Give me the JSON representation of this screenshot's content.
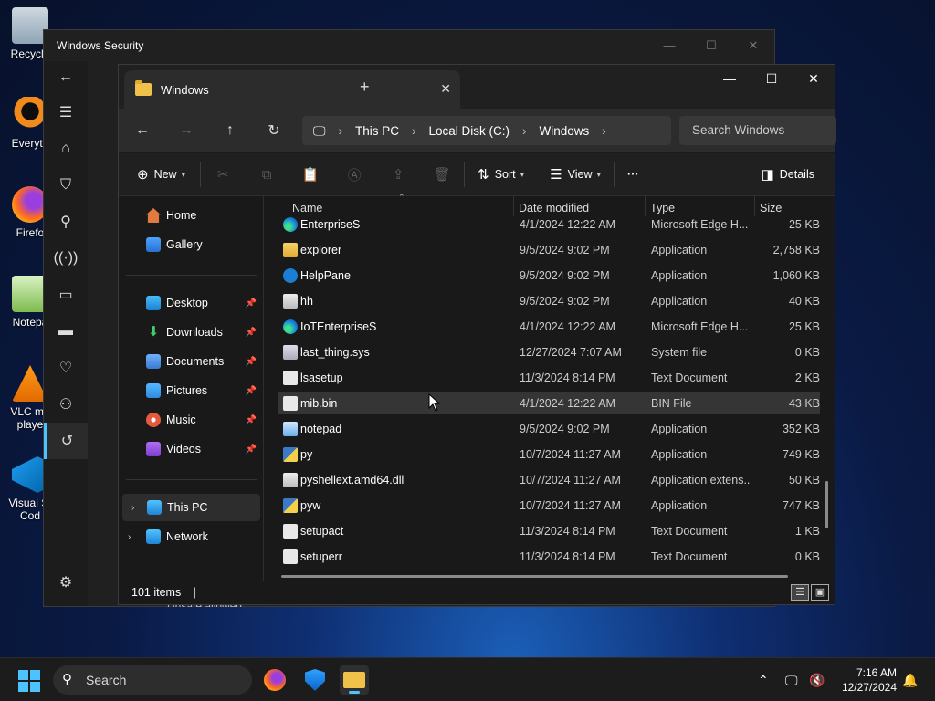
{
  "desktop": {
    "icons": [
      {
        "label": "Recycle",
        "icon": "recycle-bin-icon"
      },
      {
        "label": "Everyth",
        "icon": "everything-search-icon"
      },
      {
        "label": "Firefo",
        "icon": "firefox-icon"
      },
      {
        "label": "Notepa",
        "icon": "notepad-icon"
      },
      {
        "label": "VLC me",
        "label2": "playe",
        "icon": "vlc-icon"
      },
      {
        "label": "Visual St",
        "label2": "Cod",
        "icon": "vscode-icon"
      }
    ]
  },
  "security_window": {
    "title": "Windows Security",
    "sidebar_icons": [
      "back-arrow-icon",
      "hamburger-menu-icon",
      "home-icon",
      "shield-icon",
      "person-icon",
      "wifi-icon",
      "app-browser-icon",
      "laptop-icon",
      "heart-pulse-icon",
      "family-icon",
      "history-icon",
      "gear-icon"
    ],
    "partial_text": "Unsafe allowed"
  },
  "explorer": {
    "tab_title": "Windows",
    "breadcrumb": [
      "This PC",
      "Local Disk (C:)",
      "Windows"
    ],
    "search_placeholder": "Search Windows",
    "commands": {
      "new": "New",
      "sort": "Sort",
      "view": "View",
      "more": "···",
      "details": "Details"
    },
    "nav": {
      "home": "Home",
      "gallery": "Gallery",
      "desktop": "Desktop",
      "downloads": "Downloads",
      "documents": "Documents",
      "pictures": "Pictures",
      "music": "Music",
      "videos": "Videos",
      "this_pc": "This PC",
      "network": "Network"
    },
    "columns": {
      "name": "Name",
      "date": "Date modified",
      "type": "Type",
      "size": "Size"
    },
    "files": [
      {
        "name": "EnterpriseS",
        "date": "4/1/2024 12:22 AM",
        "type": "Microsoft Edge H...",
        "size": "25 KB",
        "icon": "edge-icon"
      },
      {
        "name": "explorer",
        "date": "9/5/2024 9:02 PM",
        "type": "Application",
        "size": "2,758 KB",
        "icon": "folder-app-icon"
      },
      {
        "name": "HelpPane",
        "date": "9/5/2024 9:02 PM",
        "type": "Application",
        "size": "1,060 KB",
        "icon": "help-icon"
      },
      {
        "name": "hh",
        "date": "9/5/2024 9:02 PM",
        "type": "Application",
        "size": "40 KB",
        "icon": "help-file-icon"
      },
      {
        "name": "IoTEnterpriseS",
        "date": "4/1/2024 12:22 AM",
        "type": "Microsoft Edge H...",
        "size": "25 KB",
        "icon": "edge-icon"
      },
      {
        "name": "last_thing.sys",
        "date": "12/27/2024 7:07 AM",
        "type": "System file",
        "size": "0 KB",
        "icon": "system-file-icon"
      },
      {
        "name": "lsasetup",
        "date": "11/3/2024 8:14 PM",
        "type": "Text Document",
        "size": "2 KB",
        "icon": "text-file-icon"
      },
      {
        "name": "mib.bin",
        "date": "4/1/2024 12:22 AM",
        "type": "BIN File",
        "size": "43 KB",
        "icon": "file-icon"
      },
      {
        "name": "notepad",
        "date": "9/5/2024 9:02 PM",
        "type": "Application",
        "size": "352 KB",
        "icon": "notepad-icon"
      },
      {
        "name": "py",
        "date": "10/7/2024 11:27 AM",
        "type": "Application",
        "size": "749 KB",
        "icon": "python-icon"
      },
      {
        "name": "pyshellext.amd64.dll",
        "date": "10/7/2024 11:27 AM",
        "type": "Application extens...",
        "size": "50 KB",
        "icon": "dll-file-icon"
      },
      {
        "name": "pyw",
        "date": "10/7/2024 11:27 AM",
        "type": "Application",
        "size": "747 KB",
        "icon": "python-icon"
      },
      {
        "name": "setupact",
        "date": "11/3/2024 8:14 PM",
        "type": "Text Document",
        "size": "1 KB",
        "icon": "text-file-icon"
      },
      {
        "name": "setuperr",
        "date": "11/3/2024 8:14 PM",
        "type": "Text Document",
        "size": "0 KB",
        "icon": "text-file-icon"
      }
    ],
    "status": "101 items"
  },
  "taskbar": {
    "search_label": "Search",
    "time": "7:16 AM",
    "date": "12/27/2024",
    "pinned": [
      "firefox-icon",
      "windows-security-icon",
      "file-explorer-icon"
    ],
    "accent": "#4cc2ff"
  }
}
